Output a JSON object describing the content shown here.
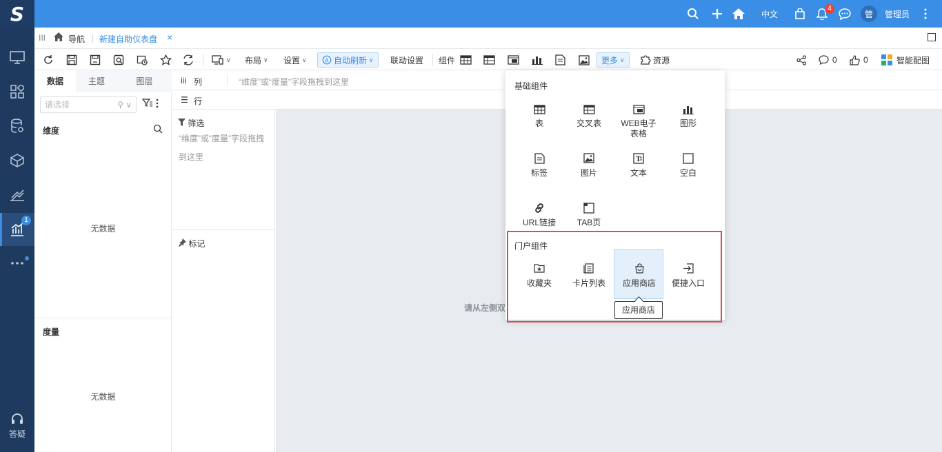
{
  "header": {
    "lang": "中文",
    "notify_count": "4",
    "avatar_text": "管",
    "username": "管理员"
  },
  "sidebar": {
    "badge": "1",
    "help": "答疑"
  },
  "tabbar": {
    "nav": "导航",
    "active_tab": "新建自助仪表盘",
    "close": "×"
  },
  "toolbar": {
    "layout": "布局",
    "settings": "设置",
    "auto_refresh": "自动刷新",
    "link_settings": "联动设置",
    "components": "组件",
    "more": "更多",
    "resources": "资源",
    "comments": "0",
    "likes": "0",
    "smart_color": "智能配图"
  },
  "datapanel": {
    "tabs": [
      "数据",
      "主题",
      "图层"
    ],
    "select_placeholder": "请选择",
    "dimension": "维度",
    "measure": "度量",
    "no_data": "无数据"
  },
  "shelf": {
    "columns": "列",
    "rows": "行",
    "filter": "筛选",
    "filter_hint": "“维度”或“度量”字段拖拽到这里",
    "mark": "标记",
    "column_hint": "“维度”或“度量”字段拖拽到这里"
  },
  "canvas": {
    "hint": "请从左侧双击或拖拽字段到上方区域，或点击工具栏组件到这里"
  },
  "dropdown": {
    "basic_title": "基础组件",
    "basic_items": [
      "表",
      "交叉表",
      "WEB电子表格",
      "图形",
      "标签",
      "图片",
      "文本",
      "空白",
      "URL链接",
      "TAB页"
    ],
    "portal_title": "门户组件",
    "portal_items": [
      "收藏夹",
      "卡片列表",
      "应用商店",
      "便捷入口"
    ],
    "tooltip": "应用商店"
  },
  "colors": {
    "header_blue": "#3a8ee6",
    "sidebar_dark": "#1f3a5f",
    "highlight_red": "#e5484d",
    "canvas_gray": "#e8ebef"
  }
}
